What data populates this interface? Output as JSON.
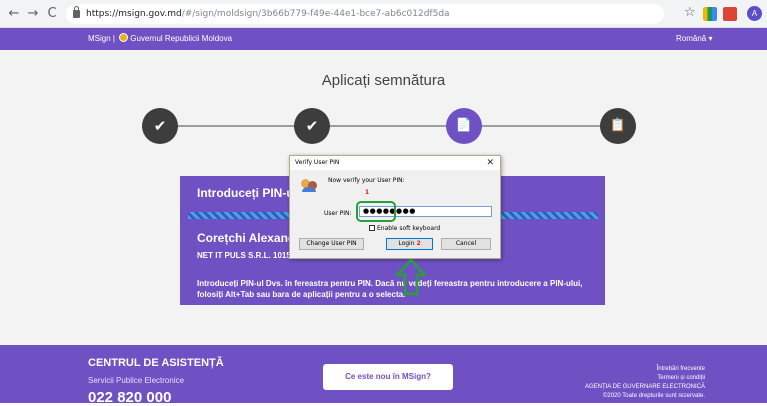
{
  "browser": {
    "back_icon": "←",
    "forward_icon": "→",
    "reload_icon": "C",
    "url_host": "https://msign.gov.md",
    "url_path": "/#/sign/moldsign/3b66b779-f49e-44e1-bce7-ab6c012df5da",
    "star_icon": "☆",
    "profile_initial": "A"
  },
  "header": {
    "brand": "MSign",
    "separator": " | ",
    "gov_name": "Guvernul Republicii Moldova",
    "language": "Română ▾"
  },
  "main": {
    "title": "Aplicați semnătura",
    "steps": [
      "✔",
      "✔",
      "📄",
      "📋"
    ],
    "pin_title": "Introduceți PIN-ul",
    "signer_name": "Corețchi Alexandru",
    "company": "NET IT PULS S.R.L. 1015",
    "instructions": "Introduceți PIN-ul Dvs. în fereastra pentru PIN. Dacă nu vedeți fereastra pentru introducere a PIN-ului, folosiți Alt+Tab sau bara de aplicații pentru a o selecta."
  },
  "dialog": {
    "title": "Verify User PIN",
    "close": "✕",
    "message": "Now verify your User PIN:",
    "annotation_1": "1",
    "pin_label": "User PIN:",
    "pin_value": "●●●●●●●●",
    "soft_keyboard_label": "Enable soft keyboard",
    "change_pin_label": "Change User PIN",
    "login_label": "Login",
    "annotation_2": "2",
    "cancel_label": "Cancel"
  },
  "footer": {
    "support_title": "CENTRUL DE ASISTENȚĂ",
    "support_subtitle": "Servicii Publice Electronice",
    "phone": "022 820 000",
    "whats_new_button": "Ce este nou în MSign?",
    "faq": "Întrebări frecvente",
    "terms": "Termeni și condiții",
    "agency": "AGENȚIA DE GUVERNARE ELECTRONICĂ",
    "copyright": "©2020 Toate drepturile sunt rezervate."
  },
  "colors": {
    "brand": "#6f51c4",
    "highlight": "#27a03c",
    "annotation": "#d81f1f"
  }
}
